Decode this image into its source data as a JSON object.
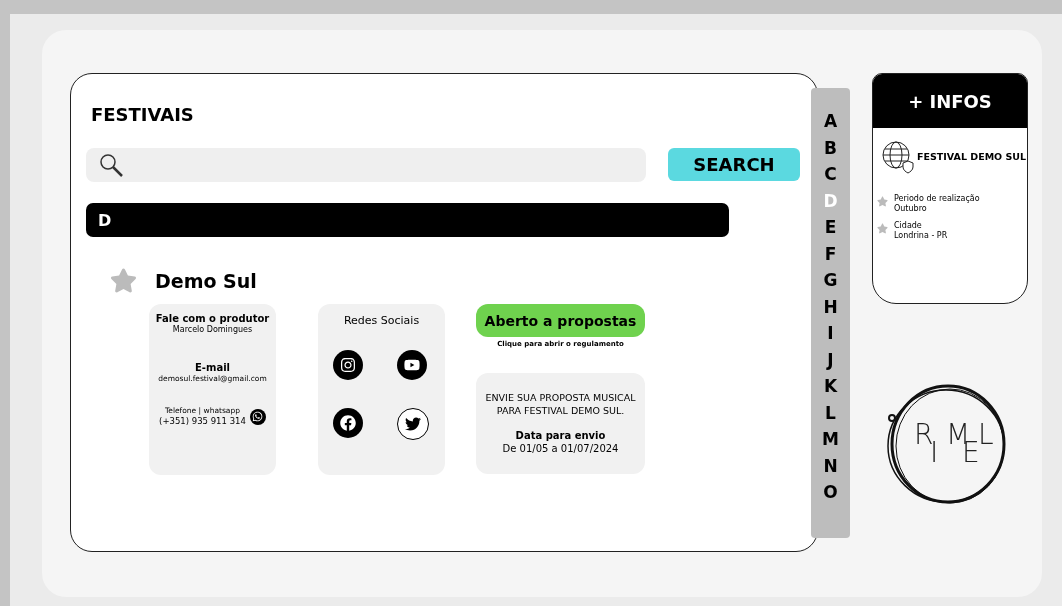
{
  "title": "FESTIVAIS",
  "search": {
    "button": "SEARCH"
  },
  "section_letter": "D",
  "festival": {
    "name": "Demo Sul",
    "contact": {
      "heading": "Fale com o produtor",
      "producer": "Marcelo Domingues",
      "email_label": "E-mail",
      "email": "demosul.festival@gmail.com",
      "phone_label": "Telefone | whatsapp",
      "phone": "(+351) 935 911 314"
    },
    "socials": {
      "heading": "Redes Sociais",
      "networks": [
        {
          "kind": "instagram"
        },
        {
          "kind": "youtube"
        },
        {
          "kind": "facebook"
        },
        {
          "kind": "twitter"
        }
      ]
    },
    "proposals": {
      "status": "Aberto a propostas",
      "hint": "Clique para abrir o regulamento",
      "message": "ENVIE SUA PROPOSTA MUSICAL PARA FESTIVAL DEMO SUL.",
      "date_label": "Data para envio",
      "date": "De 01/05 a 01/07/2024"
    }
  },
  "alphabet": [
    {
      "letter": "A",
      "selected": false
    },
    {
      "letter": "B",
      "selected": false
    },
    {
      "letter": "C",
      "selected": false
    },
    {
      "letter": "D",
      "selected": true
    },
    {
      "letter": "E",
      "selected": false
    },
    {
      "letter": "F",
      "selected": false
    },
    {
      "letter": "G",
      "selected": false
    },
    {
      "letter": "H",
      "selected": false
    },
    {
      "letter": "I",
      "selected": false
    },
    {
      "letter": "J",
      "selected": false
    },
    {
      "letter": "K",
      "selected": false
    },
    {
      "letter": "L",
      "selected": false
    },
    {
      "letter": "M",
      "selected": false
    },
    {
      "letter": "N",
      "selected": false
    },
    {
      "letter": "O",
      "selected": false
    }
  ],
  "infos": {
    "header": "+ INFOS",
    "name": "FESTIVAL DEMO SUL",
    "items": [
      {
        "label": "Periodo de realização",
        "value": "Outubro"
      },
      {
        "label": "Cidade",
        "value": "Londrina - PR"
      }
    ]
  },
  "logo": {
    "letters": [
      "R",
      "I",
      "M",
      "E",
      "L"
    ]
  }
}
